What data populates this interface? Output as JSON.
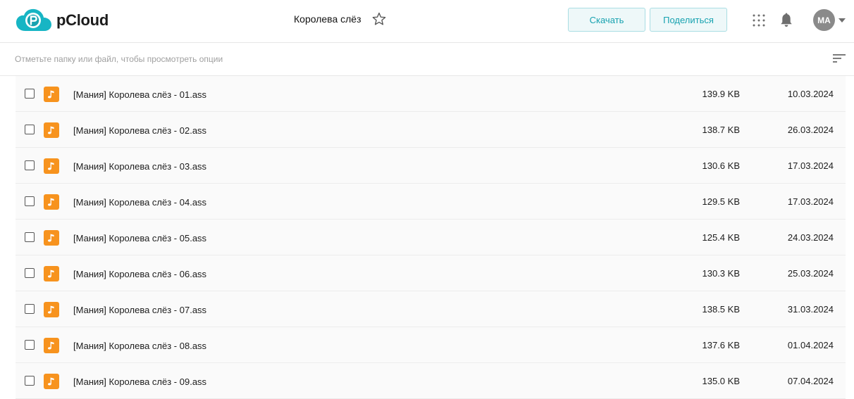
{
  "header": {
    "logo_text": "pCloud",
    "folder_title": "Королева слёз",
    "download_label": "Скачать",
    "share_label": "Поделиться",
    "avatar_initials": "MA"
  },
  "toolbar": {
    "hint": "Отметьте папку или файл, чтобы просмотреть опции"
  },
  "colors": {
    "brand": "#17a2b0",
    "file_icon": "#f7931e"
  },
  "files": [
    {
      "name": "[Мания] Королева слёз - 01.ass",
      "size": "139.9 KB",
      "date": "10.03.2024",
      "icon": "music-note-icon"
    },
    {
      "name": "[Мания] Королева слёз - 02.ass",
      "size": "138.7 KB",
      "date": "26.03.2024",
      "icon": "music-note-icon"
    },
    {
      "name": "[Мания] Королева слёз - 03.ass",
      "size": "130.6 KB",
      "date": "17.03.2024",
      "icon": "music-note-icon"
    },
    {
      "name": "[Мания] Королева слёз - 04.ass",
      "size": "129.5 KB",
      "date": "17.03.2024",
      "icon": "music-note-icon"
    },
    {
      "name": "[Мания] Королева слёз - 05.ass",
      "size": "125.4 KB",
      "date": "24.03.2024",
      "icon": "music-note-icon"
    },
    {
      "name": "[Мания] Королева слёз - 06.ass",
      "size": "130.3 KB",
      "date": "25.03.2024",
      "icon": "music-note-icon"
    },
    {
      "name": "[Мания] Королева слёз - 07.ass",
      "size": "138.5 KB",
      "date": "31.03.2024",
      "icon": "music-note-icon"
    },
    {
      "name": "[Мания] Королева слёз - 08.ass",
      "size": "137.6 KB",
      "date": "01.04.2024",
      "icon": "music-note-icon"
    },
    {
      "name": "[Мания] Королева слёз - 09.ass",
      "size": "135.0 KB",
      "date": "07.04.2024",
      "icon": "music-note-icon"
    }
  ]
}
